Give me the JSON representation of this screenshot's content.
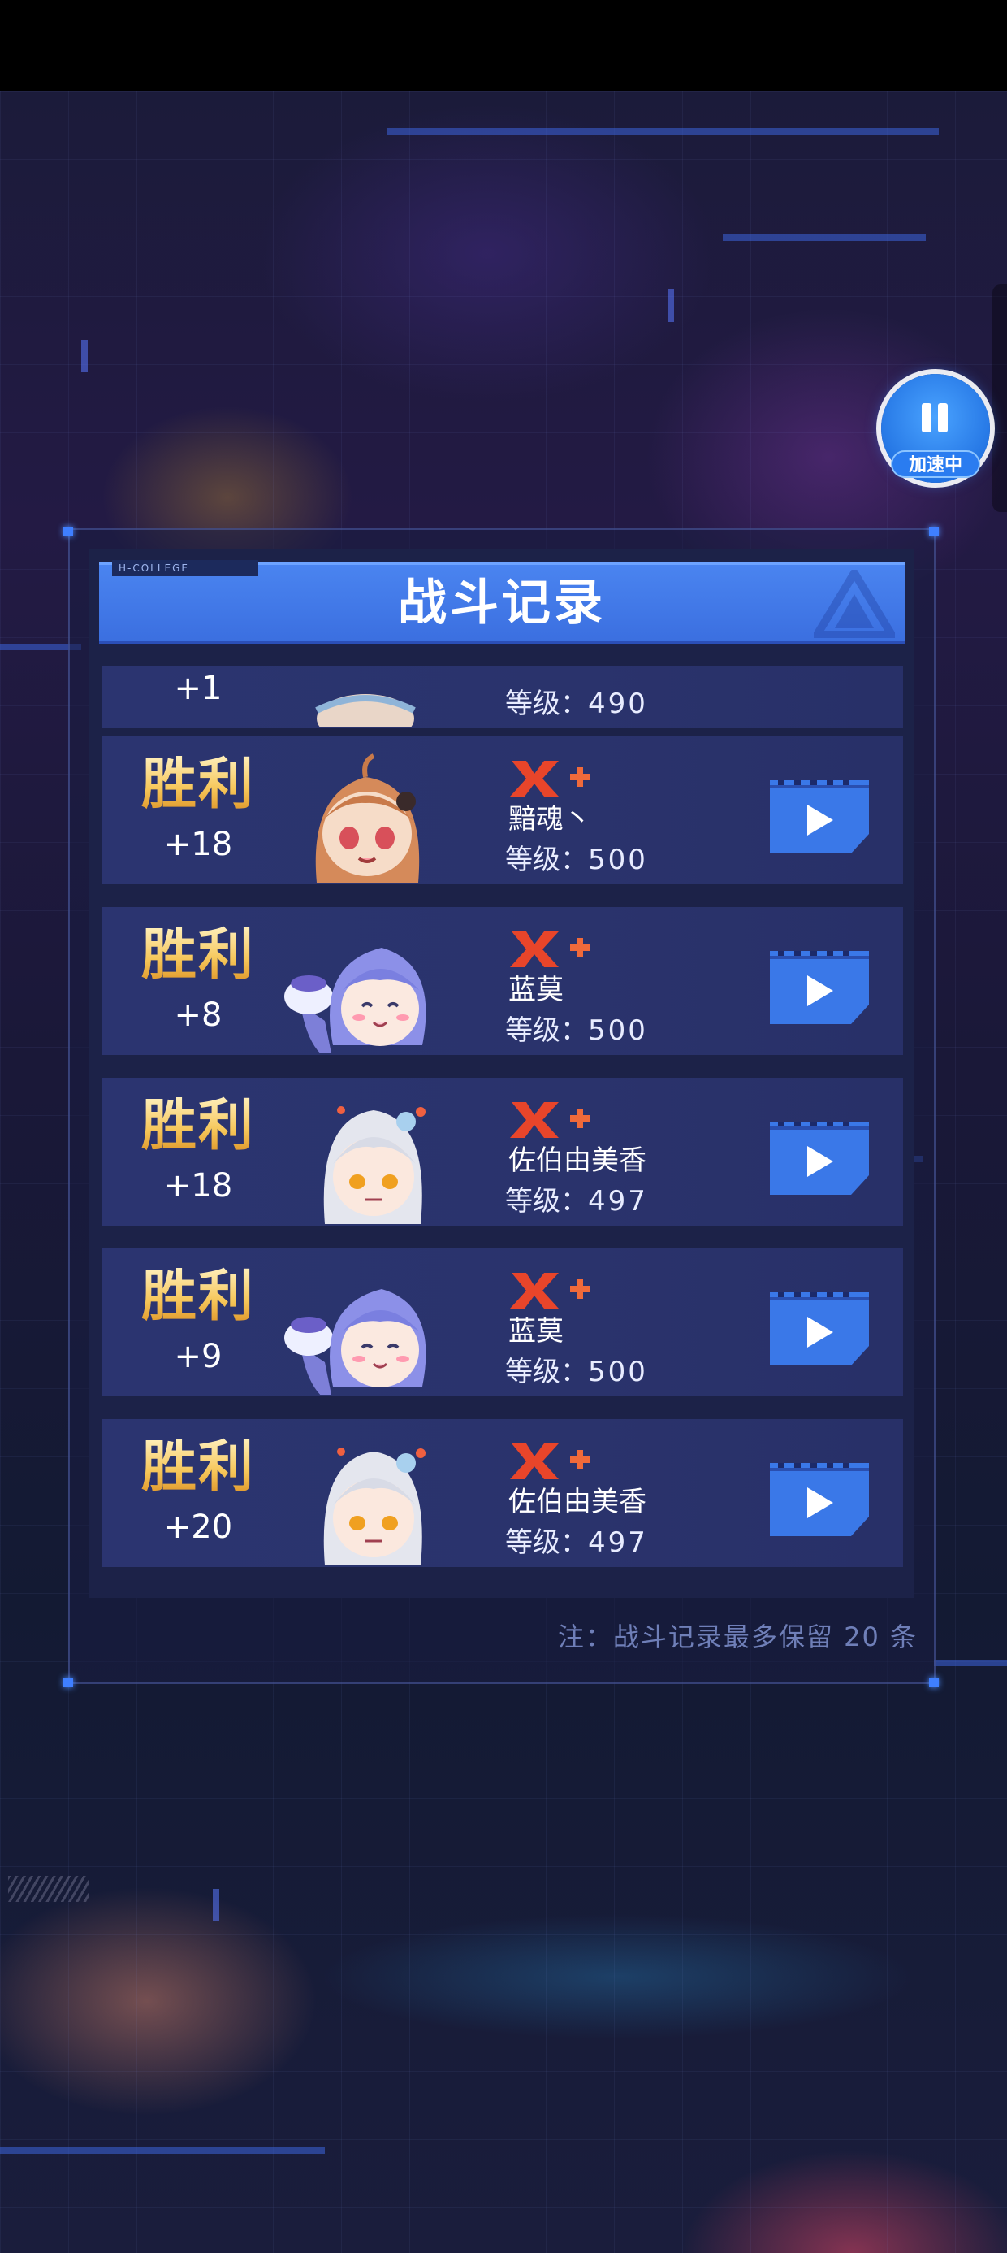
{
  "panel": {
    "title": "战斗记录",
    "title_tag": "H-COLLEGE",
    "note": "注：战斗记录最多保留 20 条"
  },
  "speed_button": {
    "label": "加速中",
    "icon": "pause-icon"
  },
  "records": [
    {
      "result": "",
      "delta": "+1",
      "name": "",
      "rank": "",
      "level_label": "等级：",
      "level": "490",
      "avatar": "partial-avatar",
      "partial": true
    },
    {
      "result": "胜利",
      "delta": "+18",
      "name": "黯魂丶",
      "rank": "X+",
      "level_label": "等级：",
      "level": "500",
      "avatar": "brown-hair-girl-avatar"
    },
    {
      "result": "胜利",
      "delta": "+8",
      "name": "蓝莫",
      "rank": "X+",
      "level_label": "等级：",
      "level": "500",
      "avatar": "blue-hair-girl-cake-avatar"
    },
    {
      "result": "胜利",
      "delta": "+18",
      "name": "佐伯由美香",
      "rank": "X+",
      "level_label": "等级：",
      "level": "497",
      "avatar": "white-hair-girl-avatar"
    },
    {
      "result": "胜利",
      "delta": "+9",
      "name": "蓝莫",
      "rank": "X+",
      "level_label": "等级：",
      "level": "500",
      "avatar": "blue-hair-girl-cake-avatar"
    },
    {
      "result": "胜利",
      "delta": "+20",
      "name": "佐伯由美香",
      "rank": "X+",
      "level_label": "等级：",
      "level": "497",
      "avatar": "white-hair-girl-avatar"
    }
  ],
  "colors": {
    "title_bar": "#3b6fe0",
    "row_bg": "#2a336c",
    "victory_gold": "#f6c75a",
    "rank_red": "#e8452a",
    "replay_blue": "#3a78e8"
  }
}
